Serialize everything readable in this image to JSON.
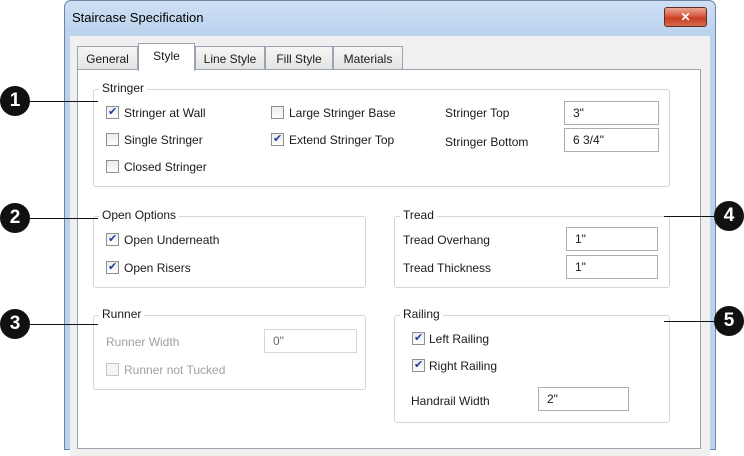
{
  "window": {
    "title": "Staircase Specification",
    "close_glyph": "✕"
  },
  "tabs": [
    {
      "label": "General",
      "active": false
    },
    {
      "label": "Style",
      "active": true
    },
    {
      "label": "Line Style",
      "active": false
    },
    {
      "label": "Fill Style",
      "active": false
    },
    {
      "label": "Materials",
      "active": false
    }
  ],
  "stringer": {
    "title": "Stringer",
    "stringer_at_wall": {
      "label": "Stringer at Wall",
      "checked": true
    },
    "single_stringer": {
      "label": "Single Stringer",
      "checked": false
    },
    "closed_stringer": {
      "label": "Closed Stringer",
      "checked": false
    },
    "large_stringer_base": {
      "label": "Large Stringer Base",
      "checked": false
    },
    "extend_stringer_top": {
      "label": "Extend Stringer Top",
      "checked": true
    },
    "stringer_top": {
      "label": "Stringer Top",
      "value": "3\""
    },
    "stringer_bottom": {
      "label": "Stringer Bottom",
      "value": "6 3/4\""
    }
  },
  "open_options": {
    "title": "Open Options",
    "open_underneath": {
      "label": "Open Underneath",
      "checked": true
    },
    "open_risers": {
      "label": "Open Risers",
      "checked": true
    }
  },
  "tread": {
    "title": "Tread",
    "overhang": {
      "label": "Tread Overhang",
      "value": "1\""
    },
    "thickness": {
      "label": "Tread Thickness",
      "value": "1\""
    }
  },
  "runner": {
    "title": "Runner",
    "width": {
      "label": "Runner Width",
      "value": "0\"",
      "disabled": true
    },
    "not_tucked": {
      "label": "Runner not Tucked",
      "checked": false,
      "disabled": true
    }
  },
  "railing": {
    "title": "Railing",
    "left": {
      "label": "Left Railing",
      "checked": true
    },
    "right": {
      "label": "Right Railing",
      "checked": true
    },
    "handrail_width": {
      "label": "Handrail Width",
      "value": "2\""
    }
  },
  "callouts": [
    "1",
    "2",
    "3",
    "4",
    "5"
  ]
}
